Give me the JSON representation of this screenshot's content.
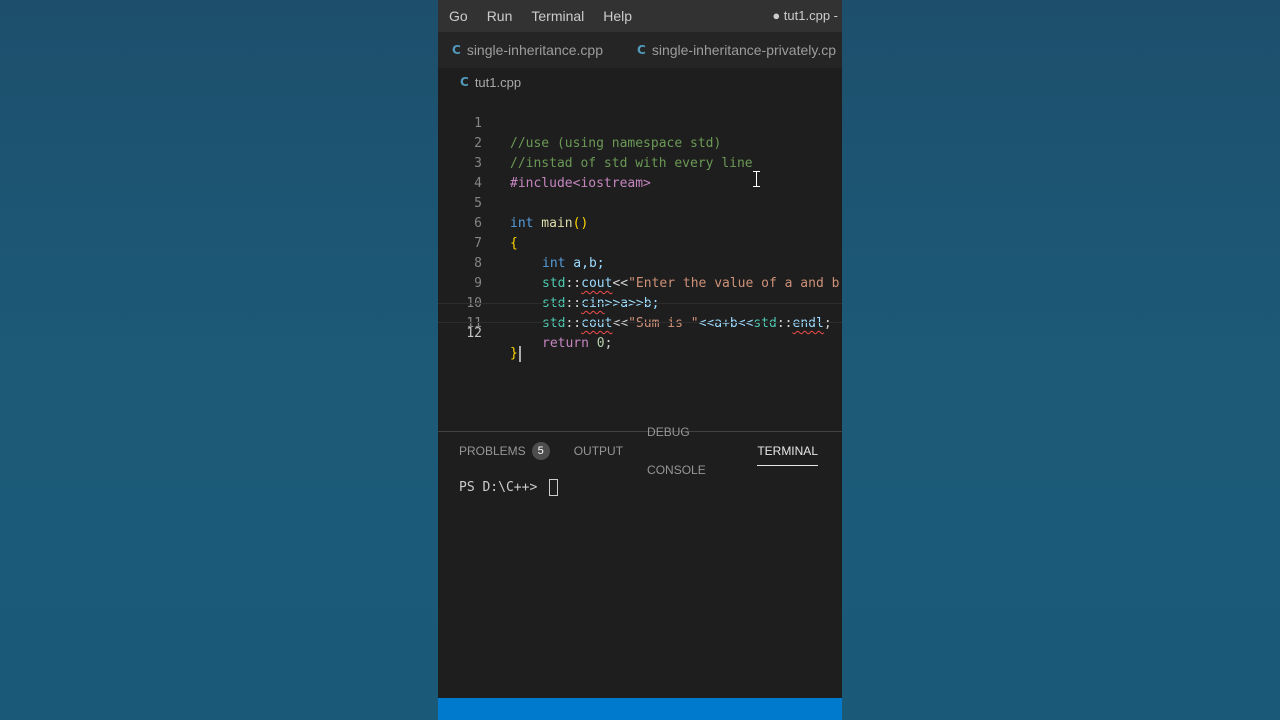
{
  "menu": [
    "Go",
    "Run",
    "Terminal",
    "Help"
  ],
  "window_title": "● tut1.cpp -",
  "tabs": [
    {
      "icon": "C",
      "label": "single-inheritance.cpp"
    },
    {
      "icon": "C",
      "label": "single-inheritance-privately.cp"
    }
  ],
  "breadcrumb": {
    "icon": "C",
    "label": "tut1.cpp"
  },
  "line_numbers": [
    "1",
    "2",
    "3",
    "4",
    "5",
    "6",
    "7",
    "8",
    "9",
    "10",
    "11",
    "12"
  ],
  "code": {
    "l1": "//use (using namespace std)",
    "l2": "//instad of std with every line",
    "l3": "#include<iostream>",
    "l5_kw": "int",
    "l5_fn": " main",
    "l5_paren": "()",
    "l6": "{",
    "l7_kw": "int",
    "l7_rest": " a,b;",
    "l8_ns": "std",
    "l8_sep": "::",
    "l8_obj": "cout",
    "l8_op": "<<",
    "l8_str": "\"Enter the value of a and b",
    "l9_ns": "std",
    "l9_sep": "::",
    "l9_obj": "cin",
    "l9_rest": ">>a>>b;",
    "l10_ns": "std",
    "l10_sep": "::",
    "l10_obj": "cout",
    "l10_op": "<<",
    "l10_str": "\"Sum is \"",
    "l10_rest": "<<a+b<<",
    "l10_ns2": "std",
    "l10_sep2": "::",
    "l10_endl": "endl",
    "l10_end": ";",
    "l11_kw": "return",
    "l11_num": " 0",
    "l11_end": ";",
    "l12": "}"
  },
  "panel_tabs": {
    "problems": "PROBLEMS",
    "problems_count": "5",
    "output": "OUTPUT",
    "debug": "DEBUG CONSOLE",
    "terminal": "TERMINAL"
  },
  "terminal_prompt": "PS D:\\C++> "
}
